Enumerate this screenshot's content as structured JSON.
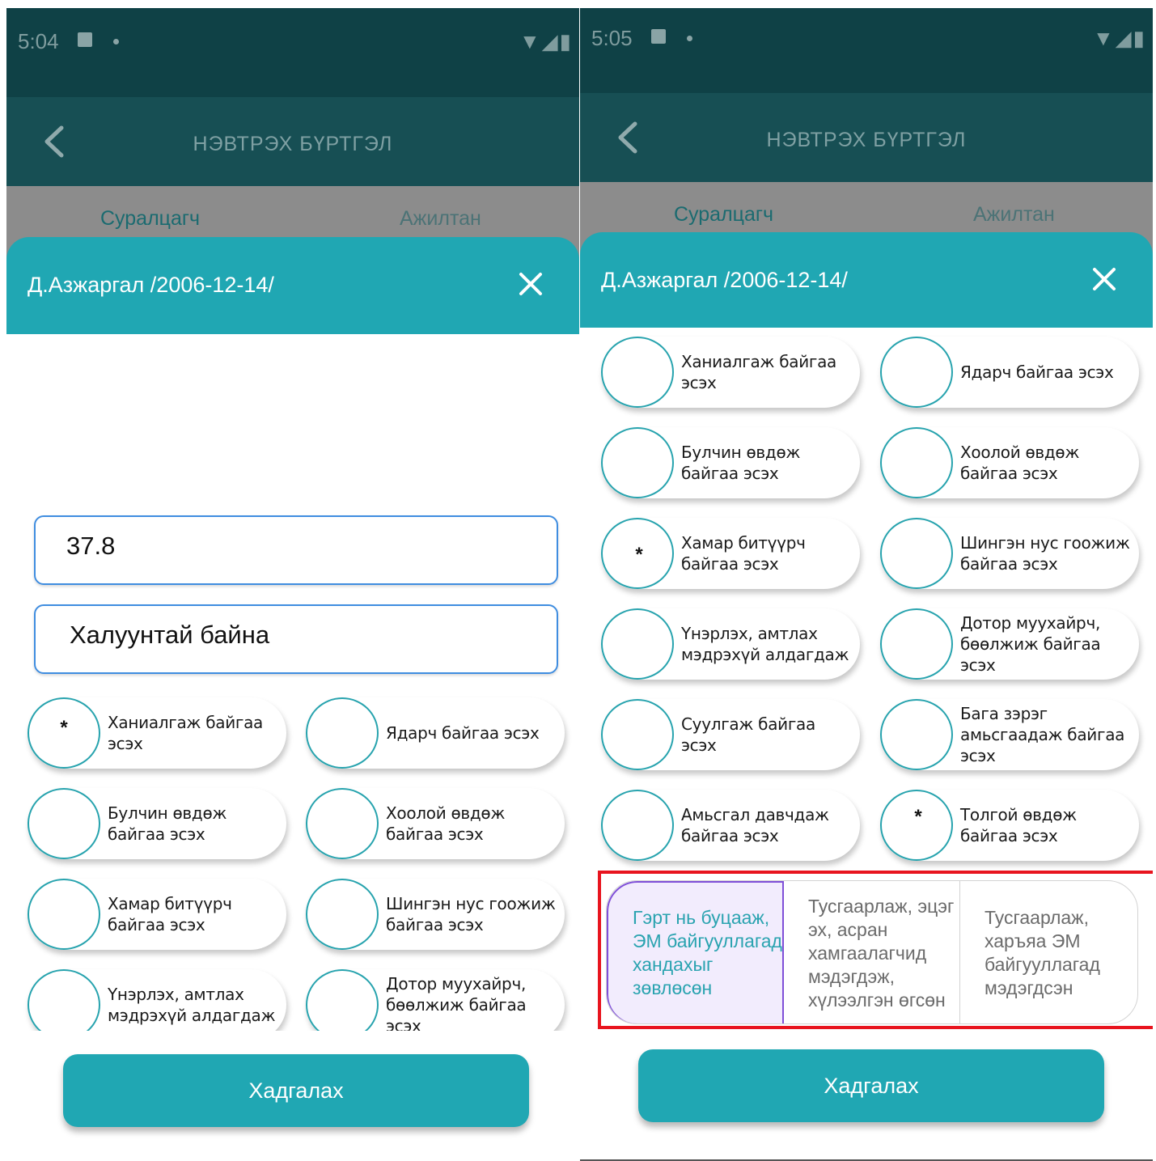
{
  "screens": [
    {
      "status": {
        "time": "5:04",
        "right": "▼◢▮"
      },
      "header": {
        "title": "НЭВТРЭХ БҮРТГЭЛ"
      },
      "tabs": [
        "Суралцагч",
        "Ажилтан"
      ],
      "sheet": {
        "title": "Д.Азжаргал /2006-12-14/",
        "temperature_value": "37.8",
        "note_value": "Халуунтай байна",
        "symptoms": [
          {
            "label": "Ханиалгаж байгаа эсэх",
            "mark": "*"
          },
          {
            "label": "Ядарч байгаа эсэх",
            "mark": ""
          },
          {
            "label": "Булчин өвдөж байгаа эсэх",
            "mark": ""
          },
          {
            "label": "Хоолой өвдөж байгаа эсэх",
            "mark": ""
          },
          {
            "label": "Хамар битүүрч байгаа эсэх",
            "mark": ""
          },
          {
            "label": "Шингэн нус гоожиж байгаа эсэх",
            "mark": ""
          },
          {
            "label": "Үнэрлэх, амтлах мэдрэхүй алдагдаж",
            "mark": ""
          },
          {
            "label": "Дотор муухайрч, бөөлжиж байгаа эсэх",
            "mark": ""
          }
        ],
        "save_label": "Хадгалах"
      }
    },
    {
      "status": {
        "time": "5:05",
        "right": "▼◢▮"
      },
      "header": {
        "title": "НЭВТРЭХ БҮРТГЭЛ"
      },
      "tabs": [
        "Суралцагч",
        "Ажилтан"
      ],
      "sheet": {
        "title": "Д.Азжаргал /2006-12-14/",
        "symptoms": [
          {
            "label": "Ханиалгаж байгаа эсэх",
            "mark": ""
          },
          {
            "label": "Ядарч байгаа эсэх",
            "mark": ""
          },
          {
            "label": "Булчин өвдөж байгаа эсэх",
            "mark": ""
          },
          {
            "label": "Хоолой өвдөж байгаа эсэх",
            "mark": ""
          },
          {
            "label": "Хамар битүүрч байгаа эсэх",
            "mark": "*"
          },
          {
            "label": "Шингэн нус гоожиж байгаа эсэх",
            "mark": ""
          },
          {
            "label": "Үнэрлэх, амтлах мэдрэхүй алдагдаж",
            "mark": ""
          },
          {
            "label": "Дотор муухайрч, бөөлжиж байгаа эсэх",
            "mark": ""
          },
          {
            "label": "Суулгаж байгаа эсэх",
            "mark": ""
          },
          {
            "label": "Бага зэрэг амьсгаадаж байгаа эсэх",
            "mark": ""
          },
          {
            "label": "Амьсгал давчдаж байгаа эсэх",
            "mark": ""
          },
          {
            "label": "Толгой өвдөж байгаа эсэх",
            "mark": "*"
          }
        ],
        "actions": {
          "selected_index": 0,
          "options": [
            "Гэрт нь буцааж, ЭМ байгууллагад хандахыг зөвлөсөн",
            "Тусгаарлаж, эцэг эх, асран хамгаалагчид мэдэгдэж, хүлээлгэн өгсөн",
            "Тусгаарлаж, харъяа ЭМ байгууллагад мэдэгдсэн"
          ]
        },
        "save_label": "Хадгалах"
      }
    }
  ],
  "colors": {
    "statusbar": "#0f4146",
    "appbar": "#174f54",
    "teal": "#20a7b3",
    "overlay_tabs": "#8c8c8c",
    "field_border": "#3f8de0",
    "selected_segment_bg": "#f2ecfd",
    "selected_segment_border": "#7f4fd8",
    "highlight_box": "#e8141e"
  },
  "icons": [
    "back-arrow-icon",
    "close-icon",
    "wifi-icon",
    "signal-icon",
    "battery-icon"
  ]
}
